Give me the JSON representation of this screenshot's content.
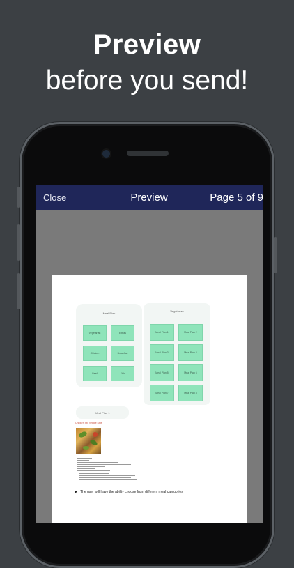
{
  "headline": {
    "line1": "Preview",
    "line2": "before you send!"
  },
  "navbar": {
    "close_label": "Close",
    "title": "Preview",
    "page_indicator": "Page 5 of 9"
  },
  "document": {
    "panel_left_title": "Meal Plan",
    "left_tiles": [
      "Vegetarian",
      "Extras",
      "Chicken",
      "Breakfast",
      "Beef",
      "Fish"
    ],
    "panel_right_title": "Vegetarian",
    "right_tiles": [
      "Meal Plan 1",
      "Meal Plan 2",
      "Meal Plan 3",
      "Meal Plan 4",
      "Meal Plan 5",
      "Meal Plan 6",
      "Meal Plan 7",
      "Meal Plan 8"
    ],
    "panel_bottom_title": "Meal Plan 1",
    "recipe_title": "Chicken Stir Veggie Stuff",
    "bullet_text": "The user will have the ability choose from different meal categories"
  },
  "colors": {
    "background": "#3c4044",
    "navbar": "#1f2659",
    "tile": "#8fe4ba",
    "screen_backdrop": "#7a7a7a"
  }
}
